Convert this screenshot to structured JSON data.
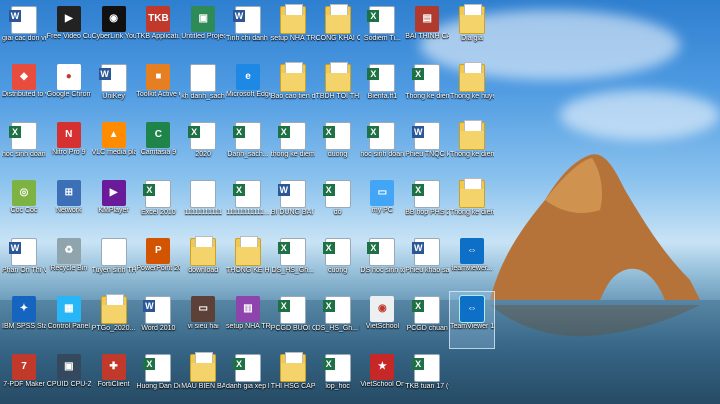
{
  "desktop_icons": [
    {
      "label": "giai cac don vi",
      "type": "doc",
      "col": 0,
      "row": 0
    },
    {
      "label": "Free Video Cutter",
      "type": "app",
      "color": "#222",
      "glyph": "▶",
      "col": 1,
      "row": 0
    },
    {
      "label": "CyberLink YouCam 6",
      "type": "app",
      "color": "#111",
      "glyph": "◉",
      "col": 2,
      "row": 0
    },
    {
      "label": "TKB Applicati...",
      "type": "app",
      "color": "#c0392b",
      "glyph": "TKB",
      "col": 3,
      "row": 0
    },
    {
      "label": "Untitled Project",
      "type": "app",
      "color": "#2e8b57",
      "glyph": "▣",
      "col": 4,
      "row": 0
    },
    {
      "label": "Tinh chi danh gia k...",
      "type": "doc",
      "col": 5,
      "row": 0
    },
    {
      "label": "setup NHA TRO 8Z ...",
      "type": "folder",
      "col": 6,
      "row": 0
    },
    {
      "label": "CONG KHAI CHAT LUO...",
      "type": "folder",
      "col": 7,
      "row": 0
    },
    {
      "label": "Sodiem Ti...",
      "type": "xls",
      "col": 8,
      "row": 0
    },
    {
      "label": "BAI THINH CAI LU PH...",
      "type": "app",
      "color": "#b03a2e",
      "glyph": "▤",
      "col": 9,
      "row": 0
    },
    {
      "label": "Dia gia",
      "type": "folder",
      "col": 10,
      "row": 0
    },
    {
      "label": "Distributed to va AnyDesk",
      "type": "app",
      "color": "#e74c3c",
      "glyph": "◆",
      "col": 0,
      "row": 1
    },
    {
      "label": "Google Chrome",
      "type": "app",
      "color": "#fff",
      "glyph": "●",
      "col": 1,
      "row": 1
    },
    {
      "label": "UniKey",
      "type": "doc",
      "col": 2,
      "row": 1
    },
    {
      "label": "Toolkit Active Office",
      "type": "app",
      "color": "#e67e22",
      "glyph": "■",
      "col": 3,
      "row": 1
    },
    {
      "label": "kh danh_sach...",
      "type": "blank",
      "col": 4,
      "row": 1
    },
    {
      "label": "Microsoft Edge",
      "type": "app",
      "color": "#1e88e5",
      "glyph": "e",
      "col": 5,
      "row": 1
    },
    {
      "label": "Bao cao tien do chuon...",
      "type": "folder",
      "col": 6,
      "row": 1
    },
    {
      "label": "TBDH TOI THIEU",
      "type": "folder",
      "col": 7,
      "row": 1
    },
    {
      "label": "Bienfa.ff1",
      "type": "xls",
      "col": 8,
      "row": 1
    },
    {
      "label": "Thong ke diem danh",
      "type": "xls",
      "col": 9,
      "row": 1
    },
    {
      "label": "Thong ke huyen Ba Be",
      "type": "folder",
      "col": 10,
      "row": 1
    },
    {
      "label": "hoc sinh doan thanh",
      "type": "xls",
      "col": 0,
      "row": 2
    },
    {
      "label": "Nitro Pro 9",
      "type": "app",
      "color": "#d63031",
      "glyph": "N",
      "col": 1,
      "row": 2
    },
    {
      "label": "VLC media player",
      "type": "app",
      "color": "#ff8c00",
      "glyph": "▲",
      "col": 2,
      "row": 2
    },
    {
      "label": "Camtasia 9",
      "type": "app",
      "color": "#1e8449",
      "glyph": "C",
      "col": 3,
      "row": 2
    },
    {
      "label": "2020",
      "type": "xls",
      "col": 4,
      "row": 2
    },
    {
      "label": "Danh_sach...",
      "type": "xls",
      "col": 5,
      "row": 2
    },
    {
      "label": "thong ke diem danh",
      "type": "xls",
      "col": 6,
      "row": 2
    },
    {
      "label": "duong",
      "type": "xls",
      "col": 7,
      "row": 2
    },
    {
      "label": "hoc sinh doan thuong",
      "type": "xls",
      "col": 8,
      "row": 2
    },
    {
      "label": "Phieu TNQC khai LI KNO",
      "type": "doc",
      "col": 9,
      "row": 2
    },
    {
      "label": "Thong ke diem cua...",
      "type": "folder",
      "col": 10,
      "row": 2
    },
    {
      "label": "Coc Coc",
      "type": "app",
      "color": "#7cb342",
      "glyph": "◎",
      "col": 0,
      "row": 3
    },
    {
      "label": "Network",
      "type": "app",
      "color": "#3d6fb6",
      "glyph": "⊞",
      "col": 1,
      "row": 3
    },
    {
      "label": "KMPlayer",
      "type": "app",
      "color": "#6a1b9a",
      "glyph": "▶",
      "col": 2,
      "row": 3
    },
    {
      "label": "Excel 2010",
      "type": "xls",
      "col": 3,
      "row": 3
    },
    {
      "label": "11111111111",
      "type": "blank",
      "col": 4,
      "row": 3
    },
    {
      "label": "11111111111...",
      "type": "xls",
      "col": 5,
      "row": 3
    },
    {
      "label": "BI DUNG BAI THI",
      "type": "doc",
      "col": 6,
      "row": 3
    },
    {
      "label": "do",
      "type": "xls",
      "col": 7,
      "row": 3
    },
    {
      "label": "my PC",
      "type": "app",
      "color": "#42a5f5",
      "glyph": "▭",
      "col": 8,
      "row": 3
    },
    {
      "label": "BB hop PHS 2...",
      "type": "xls",
      "col": 9,
      "row": 3
    },
    {
      "label": "Thong ke diem cho...",
      "type": "folder",
      "col": 10,
      "row": 3
    },
    {
      "label": "Phan On Thi Vao L...",
      "type": "doc",
      "col": 0,
      "row": 4
    },
    {
      "label": "Recycle Bin",
      "type": "app",
      "color": "#90a4ae",
      "glyph": "♻",
      "col": 1,
      "row": 4
    },
    {
      "label": "Tuyen sinh THPT 2014",
      "type": "blank",
      "col": 2,
      "row": 4
    },
    {
      "label": "PowerPoint 2010",
      "type": "app",
      "color": "#d35400",
      "glyph": "P",
      "col": 3,
      "row": 4
    },
    {
      "label": "download",
      "type": "folder",
      "col": 4,
      "row": 4
    },
    {
      "label": "THONG KE HO SO TH...",
      "type": "folder",
      "col": 5,
      "row": 4
    },
    {
      "label": "DS_HS_Gh...",
      "type": "xls",
      "col": 6,
      "row": 4
    },
    {
      "label": "cuong",
      "type": "xls",
      "col": 7,
      "row": 4
    },
    {
      "label": "DS hoc sinh toan truong",
      "type": "xls",
      "col": 8,
      "row": 4
    },
    {
      "label": "Phieu khao sat",
      "type": "doc",
      "col": 9,
      "row": 4
    },
    {
      "label": "teamviewer...",
      "type": "app",
      "color": "#0e6fc7",
      "glyph": "⇔",
      "col": 10,
      "row": 4
    },
    {
      "label": "IBM SPSS Statistics 20",
      "type": "app",
      "color": "#1565c0",
      "glyph": "✦",
      "col": 0,
      "row": 5
    },
    {
      "label": "Control Panel",
      "type": "app",
      "color": "#29b6f6",
      "glyph": "▦",
      "col": 1,
      "row": 5
    },
    {
      "label": "PTGo_2020...",
      "type": "folder",
      "col": 2,
      "row": 5
    },
    {
      "label": "Word 2010",
      "type": "doc",
      "col": 3,
      "row": 5
    },
    {
      "label": "vi sieu hai",
      "type": "app",
      "color": "#5d4037",
      "glyph": "▭",
      "col": 4,
      "row": 5
    },
    {
      "label": "setup NHA TRO 8Z",
      "type": "app",
      "color": "#8e44ad",
      "glyph": "▥",
      "col": 5,
      "row": 5
    },
    {
      "label": "PCGD BUOI CHIEU",
      "type": "xls",
      "col": 6,
      "row": 5
    },
    {
      "label": "DS_HS_Gh... (1)",
      "type": "xls",
      "col": 7,
      "row": 5
    },
    {
      "label": "VietSchool",
      "type": "app",
      "color": "#ecf0f1",
      "glyph": "◉",
      "col": 8,
      "row": 5
    },
    {
      "label": "PCGD chuan",
      "type": "xls",
      "col": 9,
      "row": 5
    },
    {
      "label": "TeamViewer 14",
      "type": "app",
      "color": "#0e6fc7",
      "glyph": "⇔",
      "col": 10,
      "row": 5,
      "selected": true
    },
    {
      "label": "7-PDF Maker",
      "type": "app",
      "color": "#c0392b",
      "glyph": "7",
      "col": 0,
      "row": 6
    },
    {
      "label": "CPUID CPU-Z",
      "type": "app",
      "color": "#34495e",
      "glyph": "▣",
      "col": 1,
      "row": 6
    },
    {
      "label": "FortiClient",
      "type": "app",
      "color": "#c0392b",
      "glyph": "✚",
      "col": 2,
      "row": 6
    },
    {
      "label": "Huong Dan Do Chong ...",
      "type": "xls",
      "col": 3,
      "row": 6
    },
    {
      "label": "MAU BIEN BAN",
      "type": "folder",
      "col": 4,
      "row": 6
    },
    {
      "label": "danh gia xep loai cong c...",
      "type": "xls",
      "col": 5,
      "row": 6
    },
    {
      "label": "THI HSG CAP TRUONG",
      "type": "folder",
      "col": 6,
      "row": 6
    },
    {
      "label": "lop_hoc",
      "type": "xls",
      "col": 7,
      "row": 6
    },
    {
      "label": "VietSchool Online",
      "type": "app",
      "color": "#c62828",
      "glyph": "★",
      "col": 8,
      "row": 6
    },
    {
      "label": "TKB tuan 17 (tam on)",
      "type": "xls",
      "col": 9,
      "row": 6
    }
  ]
}
